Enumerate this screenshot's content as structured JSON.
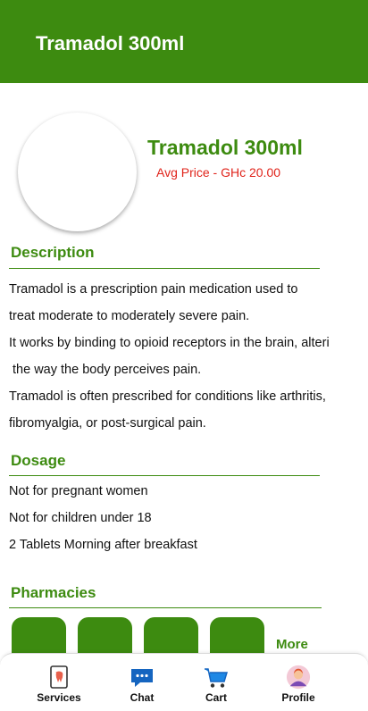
{
  "header": {
    "title": "Tramadol 300ml"
  },
  "product": {
    "name": "Tramadol 300ml",
    "price_label": "Avg Price - GHc 20.00"
  },
  "description": {
    "heading": "Description",
    "lines": [
      "Tramadol is a prescription pain medication used to",
      "treat moderate to moderately severe pain.",
      "It works by binding to opioid receptors in the brain, alteri",
      " the way the body perceives pain.",
      "Tramadol is often prescribed for conditions like arthritis,",
      "fibromyalgia, or post-surgical pain."
    ]
  },
  "dosage": {
    "heading": "Dosage",
    "lines": [
      "Not for pregnant women",
      "Not for children under 18",
      "2 Tablets Morning after breakfast"
    ]
  },
  "pharmacies": {
    "heading": "Pharmacies",
    "more_label": "More"
  },
  "bottom_nav": {
    "items": [
      {
        "label": "Services",
        "icon": "services-tooth-icon"
      },
      {
        "label": "Chat",
        "icon": "chat-bubble-icon"
      },
      {
        "label": "Cart",
        "icon": "cart-icon"
      },
      {
        "label": "Profile",
        "icon": "profile-avatar-icon"
      }
    ]
  },
  "colors": {
    "brand_green": "#3d8b10",
    "price_red": "#e0241b",
    "chat_blue": "#1565c0",
    "cart_blue": "#1e88e5"
  }
}
